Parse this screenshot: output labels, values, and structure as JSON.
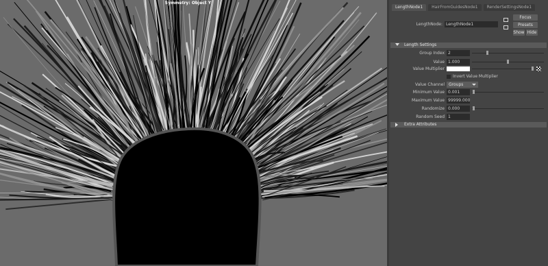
{
  "viewport": {
    "symmetry_label": "Symmetry: Object Y"
  },
  "tabs": [
    {
      "label": "LengthNode1",
      "active": true
    },
    {
      "label": "HairFromGuidesNode1",
      "active": false
    },
    {
      "label": "RenderSettingsNode1",
      "active": false
    }
  ],
  "node": {
    "label": "LengthNode:",
    "value": "LengthNode1",
    "focus_label": "Focus",
    "presets_label": "Presets",
    "show_label": "Show",
    "hide_label": "Hide"
  },
  "length_settings": {
    "title": "Length Settings",
    "group_index_label": "Group Index",
    "group_index_value": "2",
    "value_label": "Value",
    "value_value": "1.000",
    "value_multiplier_label": "Value Multiplier",
    "invert_label": "Invert Value Multiplier",
    "value_channel_label": "Value Channel",
    "value_channel_value": "Groups",
    "minimum_value_label": "Minimum Value",
    "minimum_value_value": "0.001",
    "maximum_value_label": "Maximum Value",
    "maximum_value_value": "99999.000",
    "randomize_label": "Randomize",
    "randomize_value": "0.000",
    "random_seed_label": "Random Seed",
    "random_seed_value": "1"
  },
  "extra_attributes": {
    "title": "Extra Attributes"
  },
  "colors": {
    "viewport_bg": "#6b6b6b",
    "panel_bg": "#444444",
    "section_bg": "#5a5a5a",
    "field_bg": "#2b2b2b"
  }
}
